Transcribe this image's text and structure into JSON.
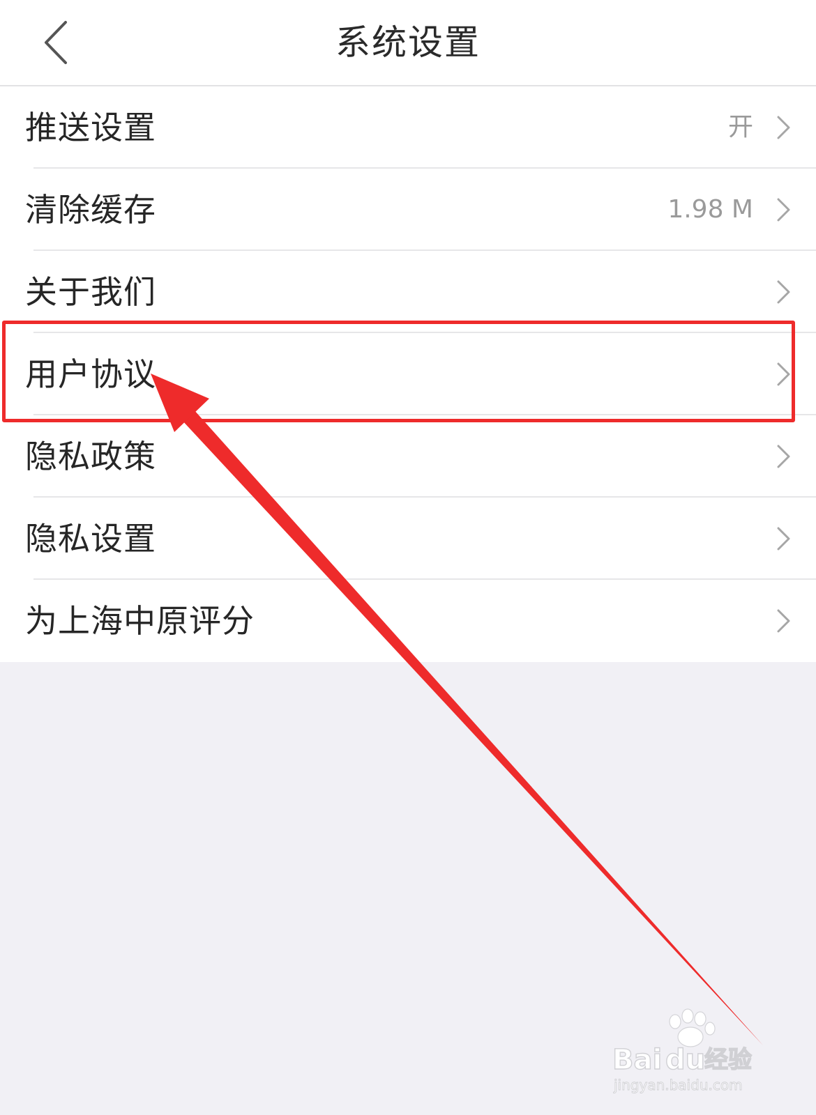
{
  "nav": {
    "title": "系统设置",
    "back_icon": "chevron-left-icon"
  },
  "settings": {
    "rows": [
      {
        "label": "推送设置",
        "value": "开"
      },
      {
        "label": "清除缓存",
        "value": "1.98 M"
      },
      {
        "label": "关于我们",
        "value": ""
      },
      {
        "label": "用户协议",
        "value": ""
      },
      {
        "label": "隐私政策",
        "value": ""
      },
      {
        "label": "隐私设置",
        "value": ""
      },
      {
        "label": "为上海中原评分",
        "value": ""
      }
    ],
    "chevron_icon": "chevron-right-icon"
  },
  "annotation": {
    "highlight_color": "#ee2b2b",
    "highlighted_row": "用户协议"
  },
  "watermark": {
    "brand": "Baidu经验",
    "url": "jingyan.baidu.com"
  },
  "colors": {
    "background": "#f1f0f5",
    "surface": "#ffffff",
    "text": "#262626",
    "secondary_text": "#9a9a9a",
    "divider": "#e6e6e8",
    "chevron": "#a6a6a6"
  }
}
